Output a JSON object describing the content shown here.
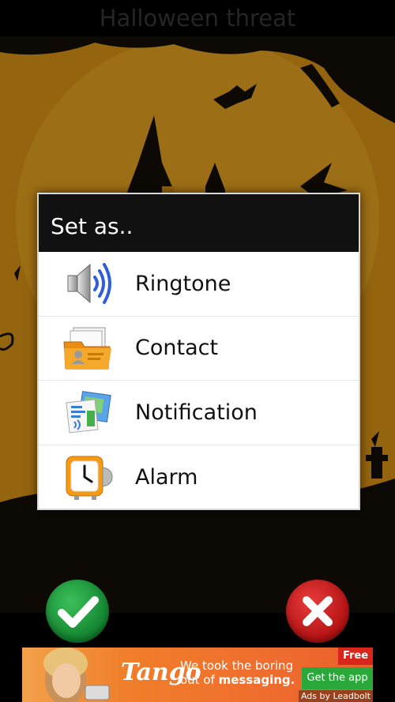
{
  "app": {
    "title": "Halloween threat"
  },
  "dialog": {
    "title": "Set as..",
    "options": [
      {
        "label": "Ringtone",
        "icon": "speaker-icon"
      },
      {
        "label": "Contact",
        "icon": "contact-folder-icon"
      },
      {
        "label": "Notification",
        "icon": "notification-icon"
      },
      {
        "label": "Alarm",
        "icon": "alarm-clock-icon"
      }
    ]
  },
  "actions": {
    "ok_icon": "checkmark-icon",
    "cancel_icon": "x-icon"
  },
  "ad": {
    "brand": "Tango",
    "text_line1": "We took the boring",
    "text_line2_prefix": "out of ",
    "text_line2_bold": "messaging.",
    "badge": "Free",
    "cta": "Get the app",
    "attribution": "Ads by Leadbolt"
  },
  "colors": {
    "scene_orange": "#f0a31a",
    "dialog_header": "#111111",
    "ok_green": "#12822f",
    "cancel_red": "#b31212"
  }
}
